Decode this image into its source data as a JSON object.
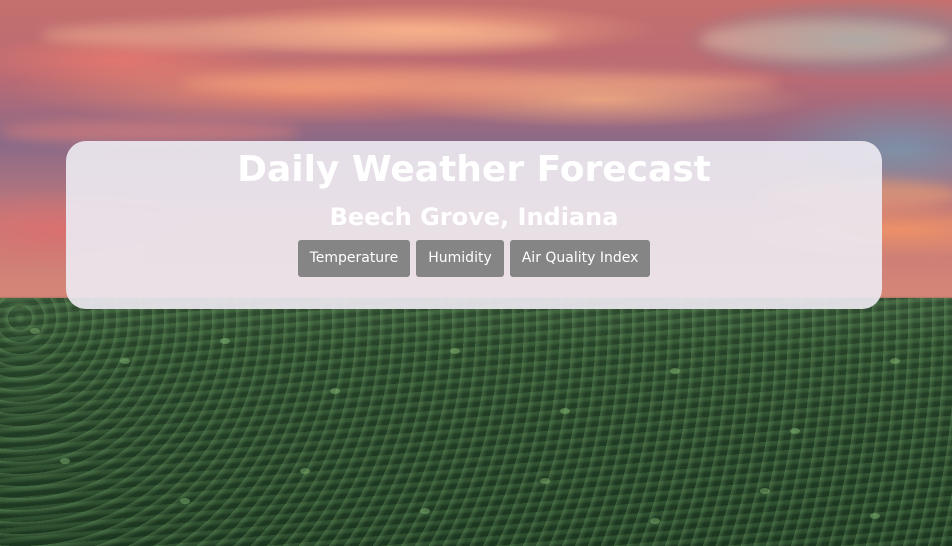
{
  "header": {
    "title": "Daily Weather Forecast",
    "location": "Beech Grove, Indiana"
  },
  "buttons": [
    {
      "label": "Temperature"
    },
    {
      "label": "Humidity"
    },
    {
      "label": "Air Quality Index"
    }
  ],
  "colors": {
    "card_background": "#ece8f0",
    "button_background": "#858585",
    "text": "#ffffff"
  }
}
